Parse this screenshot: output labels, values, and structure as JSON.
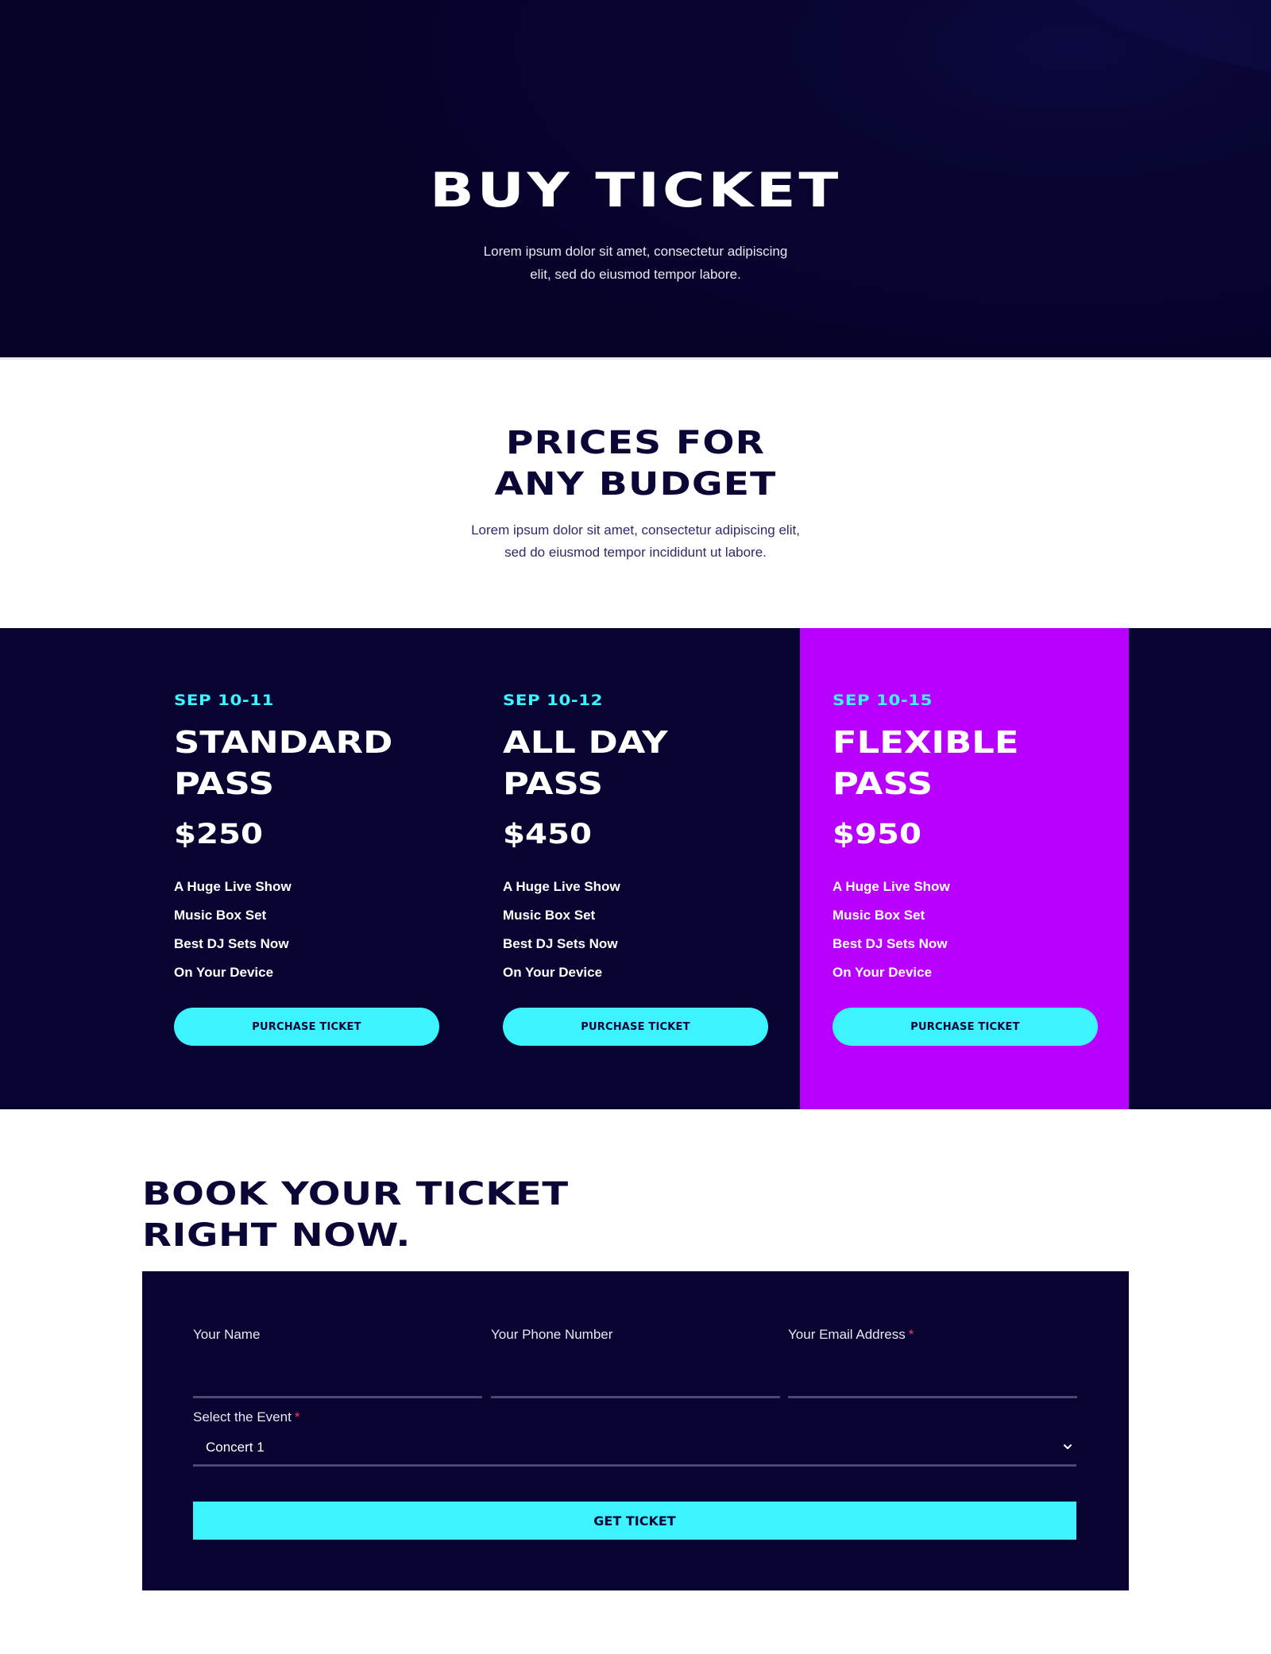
{
  "hero": {
    "title": "BUY TICKET",
    "subtitle": "Lorem ipsum dolor sit amet, consectetur adipiscing elit, sed do eiusmod tempor labore."
  },
  "prices": {
    "title_line1": "PRICES FOR",
    "title_line2": "ANY BUDGET",
    "subtitle": "Lorem ipsum dolor sit amet, consectetur adipiscing elit, sed do eiusmod tempor incididunt ut labore."
  },
  "cards": [
    {
      "date": "SEP 10-11",
      "title_line1": "STANDARD",
      "title_line2": "PASS",
      "price": "$250",
      "features": [
        "A Huge Live Show",
        "Music Box Set",
        "Best DJ Sets Now",
        "On Your Device"
      ],
      "button": "PURCHASE TICKET"
    },
    {
      "date": "SEP 10-12",
      "title_line1": "ALL DAY",
      "title_line2": "PASS",
      "price": "$450",
      "features": [
        "A Huge Live Show",
        "Music Box Set",
        "Best DJ Sets Now",
        "On Your Device"
      ],
      "button": "PURCHASE TICKET"
    },
    {
      "date": "SEP 10-15",
      "title_line1": "FLEXIBLE",
      "title_line2": "PASS",
      "price": "$950",
      "features": [
        "A Huge Live Show",
        "Music Box Set",
        "Best DJ Sets Now",
        "On Your Device"
      ],
      "button": "PURCHASE TICKET"
    }
  ],
  "book": {
    "title_line1": "BOOK YOUR TICKET",
    "title_line2": "RIGHT NOW.",
    "name_label": "Your Name",
    "phone_label": "Your Phone Number",
    "email_label": "Your Email Address",
    "required_mark": "*",
    "event_label": "Select the Event",
    "event_value": "Concert 1",
    "submit": "GET TICKET"
  },
  "colors": {
    "navy": "#070432",
    "accent_cyan": "#3cf3ff",
    "featured_purple": "#b800ff",
    "required_red": "#ff3a5c"
  }
}
